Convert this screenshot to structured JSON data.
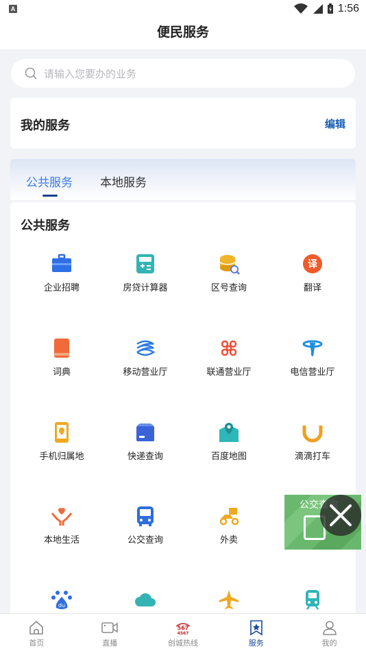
{
  "status": {
    "time": "1:56",
    "notification_glyph": "A"
  },
  "header": {
    "title": "便民服务"
  },
  "search": {
    "placeholder": "请输入您要办的业务"
  },
  "my_services": {
    "title": "我的服务",
    "edit_label": "编辑"
  },
  "tabs": [
    {
      "label": "公共服务",
      "active": true
    },
    {
      "label": "本地服务",
      "active": false
    }
  ],
  "section": {
    "title": "公共服务"
  },
  "services": [
    {
      "label": "企业招聘",
      "icon": "briefcase-icon",
      "color": "#2f6fe8"
    },
    {
      "label": "房贷计算器",
      "icon": "calculator-icon",
      "color": "#34b3b5"
    },
    {
      "label": "区号查询",
      "icon": "coins-search-icon",
      "color": "#f0b429"
    },
    {
      "label": "翻译",
      "icon": "translate-icon",
      "color": "#f05a2a"
    },
    {
      "label": "词典",
      "icon": "book-icon",
      "color": "#f06a3a"
    },
    {
      "label": "移动营业厅",
      "icon": "china-mobile-icon",
      "color": "#2e7ae6"
    },
    {
      "label": "联通营业厅",
      "icon": "china-unicom-icon",
      "color": "#f04e37"
    },
    {
      "label": "电信营业厅",
      "icon": "china-telecom-icon",
      "color": "#1c8fe0"
    },
    {
      "label": "手机归属地",
      "icon": "phone-location-icon",
      "color": "#f0a820"
    },
    {
      "label": "快递查询",
      "icon": "package-icon",
      "color": "#3a63d8"
    },
    {
      "label": "百度地图",
      "icon": "map-icon",
      "color": "#2eb6b8"
    },
    {
      "label": "滴滴打车",
      "icon": "didi-icon",
      "color": "#f0a020"
    },
    {
      "label": "本地生活",
      "icon": "hands-heart-icon",
      "color": "#f06a3a"
    },
    {
      "label": "公交查询",
      "icon": "bus-icon",
      "color": "#2e6de0"
    },
    {
      "label": "外卖",
      "icon": "scooter-icon",
      "color": "#f0a820"
    },
    {
      "label": "",
      "icon": "hidden-icon",
      "color": "#ffffff"
    },
    {
      "label": "",
      "icon": "baidu-paw-icon",
      "color": "#2e6de0"
    },
    {
      "label": "",
      "icon": "cloud-icon",
      "color": "#34b3b5"
    },
    {
      "label": "",
      "icon": "airplane-icon",
      "color": "#f0a820"
    },
    {
      "label": "",
      "icon": "train-icon",
      "color": "#2eb6b8"
    }
  ],
  "float_ad": {
    "text": "公交查询"
  },
  "bottom_nav": [
    {
      "label": "首页",
      "icon": "home-icon",
      "active": false
    },
    {
      "label": "直播",
      "icon": "video-icon",
      "active": false
    },
    {
      "label": "创城热线",
      "icon": "hotline-icon",
      "active": false,
      "badge_top": "567",
      "badge_bottom": "4567"
    },
    {
      "label": "服务",
      "icon": "star-bookmark-icon",
      "active": true
    },
    {
      "label": "我的",
      "icon": "user-icon",
      "active": false
    }
  ]
}
